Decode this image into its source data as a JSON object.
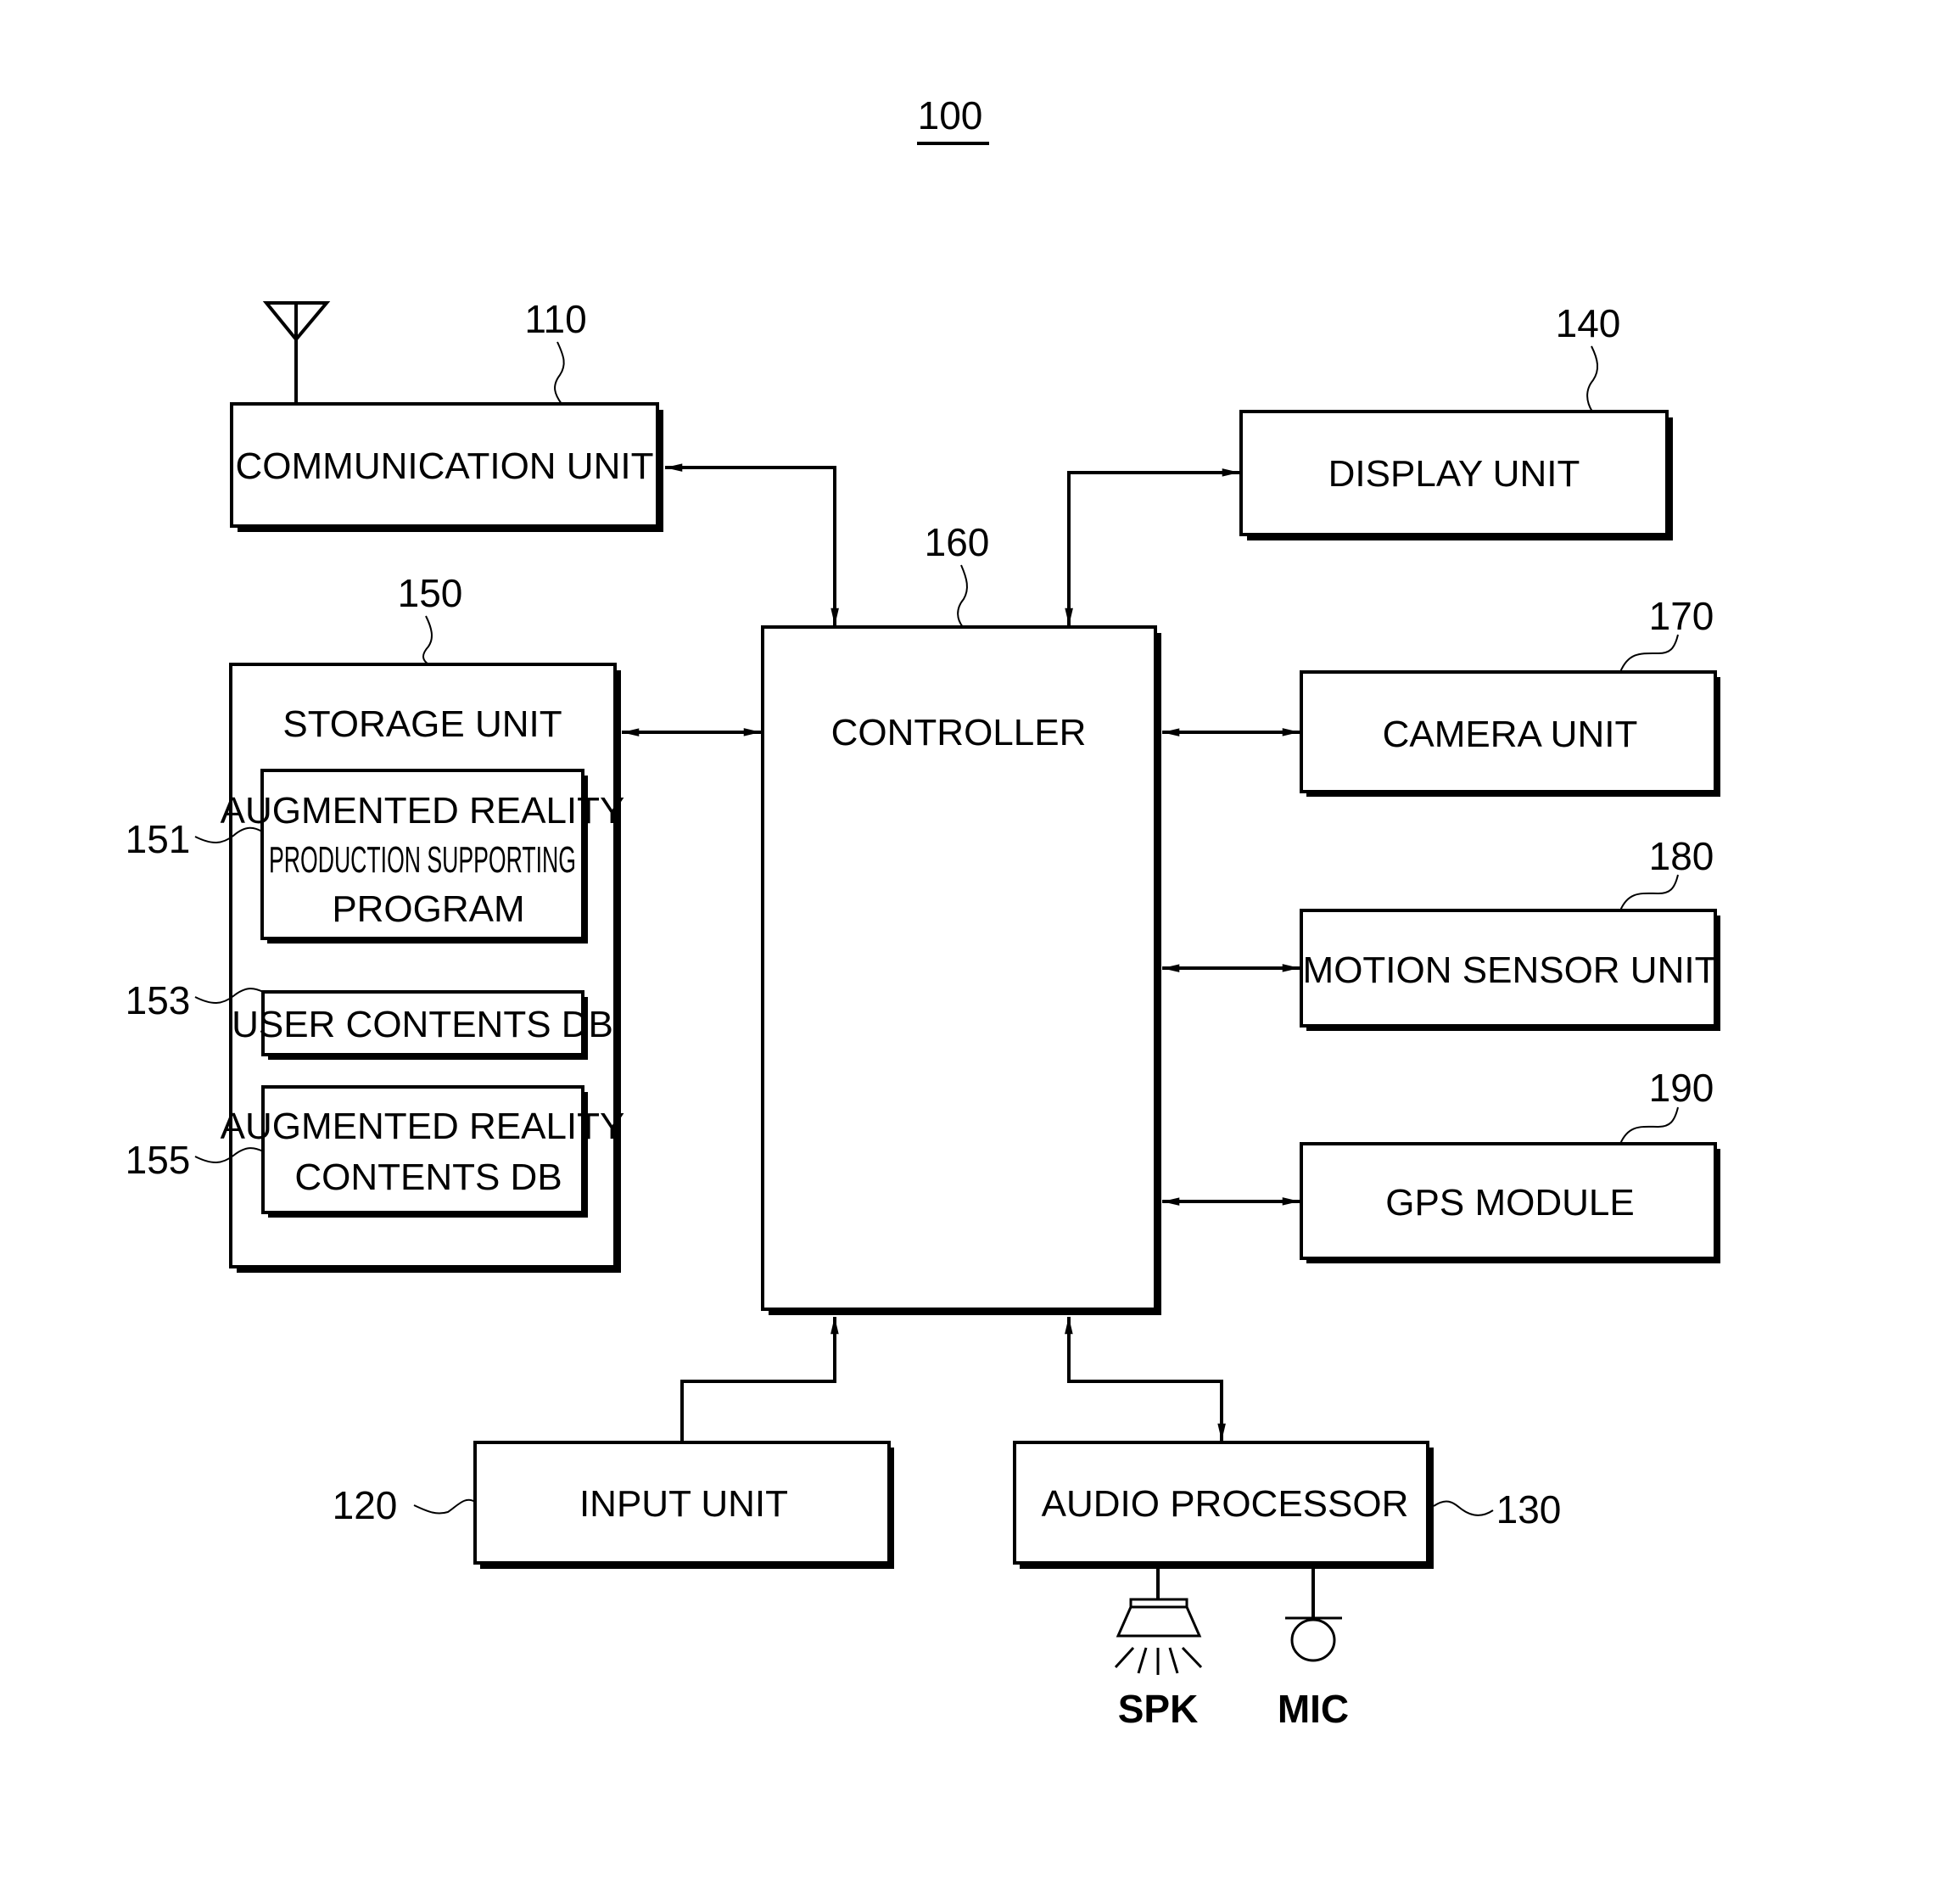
{
  "figure": {
    "ref": "100",
    "blocks": {
      "communication": {
        "ref": "110",
        "lines": [
          "COMMUNICATION UNIT"
        ]
      },
      "input": {
        "ref": "120",
        "lines": [
          "INPUT UNIT"
        ]
      },
      "audio": {
        "ref": "130",
        "lines": [
          "AUDIO PROCESSOR"
        ]
      },
      "display": {
        "ref": "140",
        "lines": [
          "DISPLAY UNIT"
        ]
      },
      "storage": {
        "ref": "150",
        "lines": [
          "STORAGE UNIT"
        ]
      },
      "ar_program": {
        "ref": "151",
        "lines": [
          "AUGMENTED REALITY",
          "PRODUCTION SUPPORTING",
          "PROGRAM"
        ]
      },
      "user_db": {
        "ref": "153",
        "lines": [
          "USER CONTENTS DB"
        ]
      },
      "ar_db": {
        "ref": "155",
        "lines": [
          "AUGMENTED REALITY",
          "CONTENTS DB"
        ]
      },
      "controller": {
        "ref": "160",
        "lines": [
          "CONTROLLER"
        ]
      },
      "camera": {
        "ref": "170",
        "lines": [
          "CAMERA UNIT"
        ]
      },
      "motion": {
        "ref": "180",
        "lines": [
          "MOTION SENSOR UNIT"
        ]
      },
      "gps": {
        "ref": "190",
        "lines": [
          "GPS MODULE"
        ]
      }
    },
    "peripherals": {
      "speaker": {
        "label": "SPK",
        "icon": "speaker-icon"
      },
      "microphone": {
        "label": "MIC",
        "icon": "microphone-icon"
      },
      "antenna": {
        "icon": "antenna-icon"
      }
    },
    "connections": [
      {
        "from": "communication",
        "to": "controller",
        "direction": "bidirectional"
      },
      {
        "from": "display",
        "to": "controller",
        "direction": "bidirectional"
      },
      {
        "from": "storage",
        "to": "controller",
        "direction": "bidirectional"
      },
      {
        "from": "camera",
        "to": "controller",
        "direction": "bidirectional"
      },
      {
        "from": "motion",
        "to": "controller",
        "direction": "bidirectional"
      },
      {
        "from": "gps",
        "to": "controller",
        "direction": "bidirectional"
      },
      {
        "from": "input",
        "to": "controller",
        "direction": "to-controller"
      },
      {
        "from": "audio",
        "to": "controller",
        "direction": "bidirectional"
      }
    ]
  }
}
